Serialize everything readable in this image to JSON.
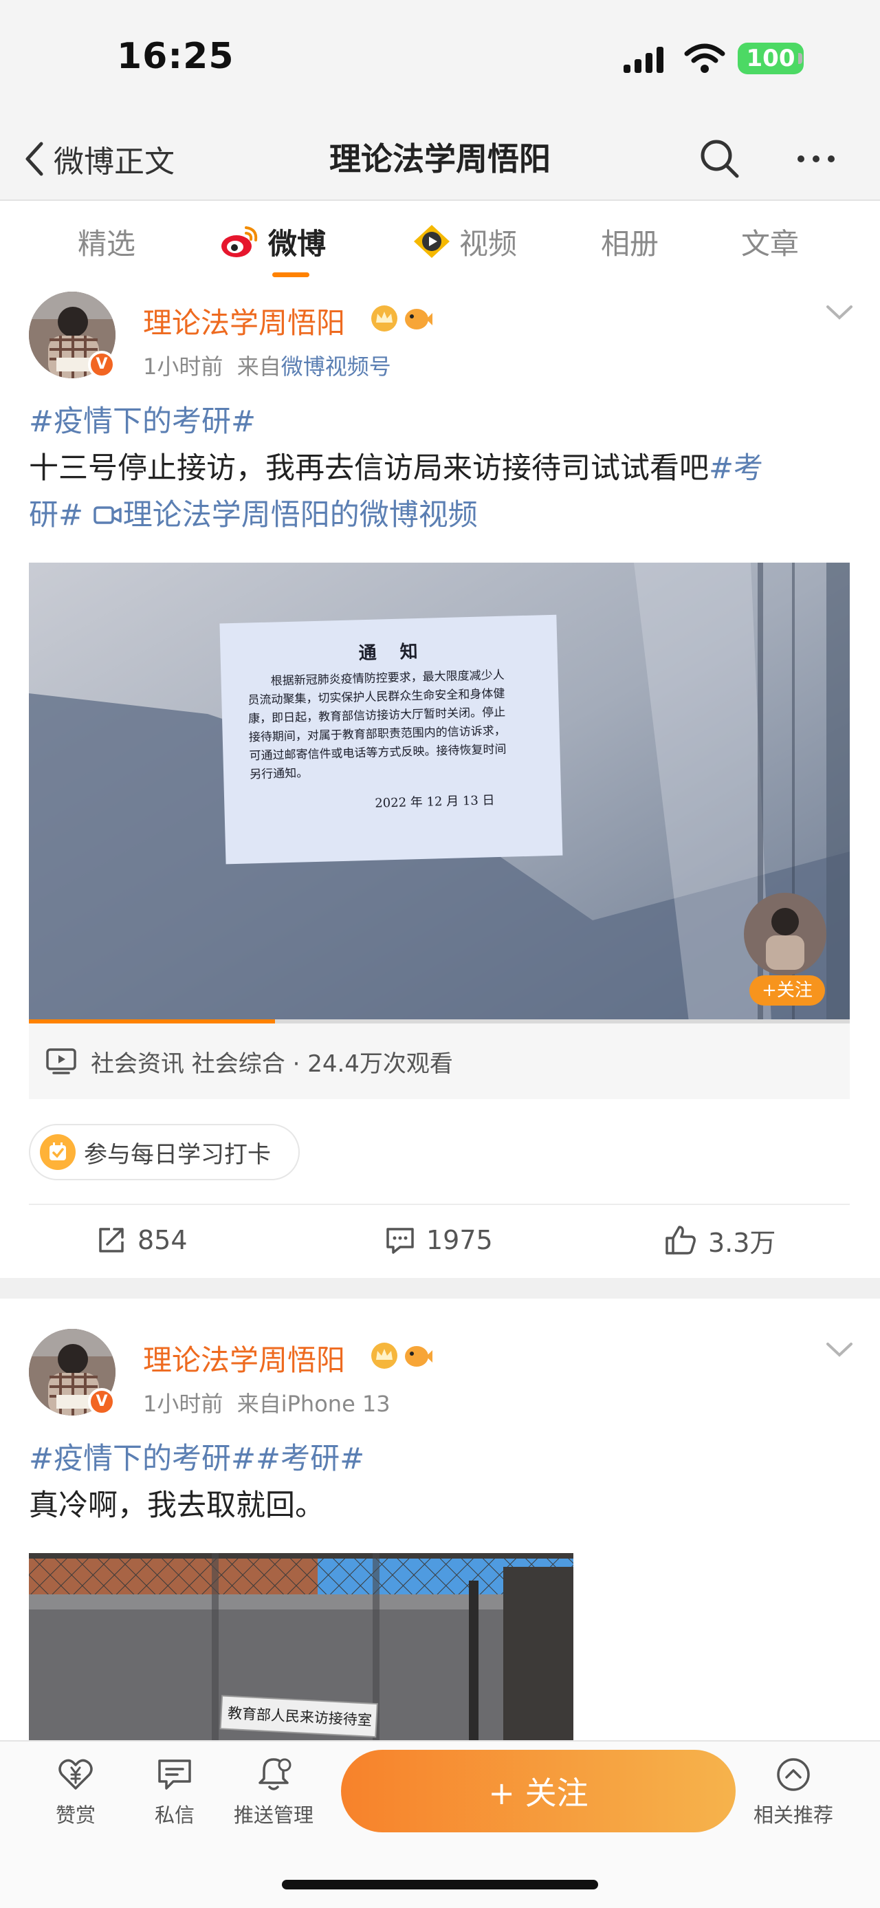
{
  "status": {
    "time": "16:25",
    "battery": "100"
  },
  "nav": {
    "back_label": "微博正文",
    "title": "理论法学周悟阳"
  },
  "tabs": [
    "精选",
    "微博",
    "视频",
    "相册",
    "文章"
  ],
  "accent": "#ff8200",
  "post1": {
    "author": "理论法学周悟阳",
    "verified": "V",
    "time": "1小时前",
    "from_prefix": "来自",
    "source": "微博视频号",
    "line1": "#疫情下的考研#",
    "line2_text": "十三号停止接访，我再去信访局来访接待司试试看吧",
    "line2_tag": "#考",
    "line3_tag": "研#",
    "line3_link": "理论法学周悟阳的微博视频",
    "notice": {
      "title": "通　知",
      "lines": [
        "根据新冠肺炎疫情防控要求，最大限度减少人",
        "员流动聚集，切实保护人民群众生命安全和身体健",
        "康，即日起，教育部信访接访大厅暂时关闭。停止",
        "接待期间，对属于教育部职责范围内的信访诉求，",
        "可通过邮寄信件或电话等方式反映。接待恢复时间",
        "另行通知。"
      ],
      "date": "2022 年 12 月 13 日"
    },
    "video_follow": "+关注",
    "video_progress": 0.3,
    "video_meta": "社会资讯 社会综合 · 24.4万次观看",
    "checkin": "参与每日学习打卡",
    "reposts": "854",
    "comments": "1975",
    "likes": "3.3万"
  },
  "post2": {
    "author": "理论法学周悟阳",
    "verified": "V",
    "time": "1小时前",
    "from_prefix": "来自",
    "source": "iPhone 13",
    "tags": "#疫情下的考研##考研#",
    "text": "真冷啊，我去取就回。",
    "sign": "教育部人民来访接待室"
  },
  "bottom": {
    "reward": "赞赏",
    "message": "私信",
    "push": "推送管理",
    "follow": "+ 关注",
    "related": "相关推荐"
  }
}
